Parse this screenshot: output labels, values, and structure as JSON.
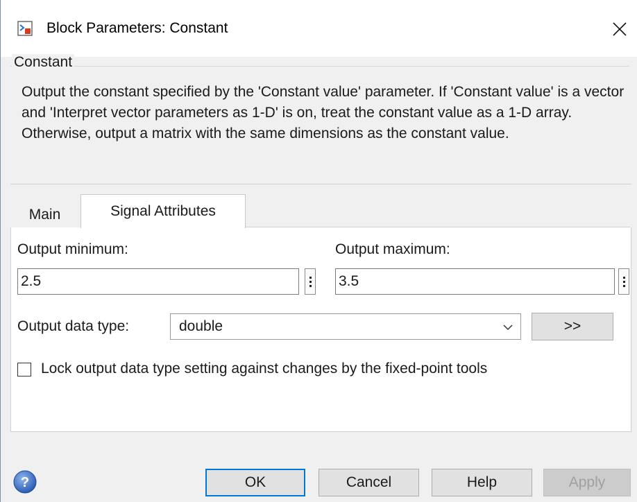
{
  "window": {
    "title": "Block Parameters: Constant"
  },
  "description": {
    "group_label": "Constant",
    "text": "Output the constant specified by the 'Constant value' parameter. If 'Constant value' is a vector and 'Interpret vector parameters as 1-D' is on, treat the constant value as a 1-D array. Otherwise, output a matrix with the same dimensions as the constant value."
  },
  "tabs": [
    {
      "label": "Main",
      "selected": false
    },
    {
      "label": "Signal Attributes",
      "selected": true
    }
  ],
  "fields": {
    "output_minimum": {
      "label": "Output minimum:",
      "value": "2.5"
    },
    "output_maximum": {
      "label": "Output maximum:",
      "value": "3.5"
    },
    "output_data_type": {
      "label": "Output data type:",
      "value": "double"
    },
    "data_type_assistant_label": ">>",
    "lock_checkbox": {
      "label": "Lock output data type setting against changes by the fixed-point tools",
      "checked": false
    }
  },
  "buttons": {
    "ok": "OK",
    "cancel": "Cancel",
    "help": "Help",
    "apply": "Apply"
  },
  "icons": {
    "app": "simulink-block-icon",
    "close": "close-icon",
    "help": "help-question-icon",
    "dropdown": "chevron-down-icon"
  },
  "colors": {
    "window_bg": "#f0f0f0",
    "ok_border": "#0078d7",
    "disabled_text": "#a0a0a0"
  }
}
